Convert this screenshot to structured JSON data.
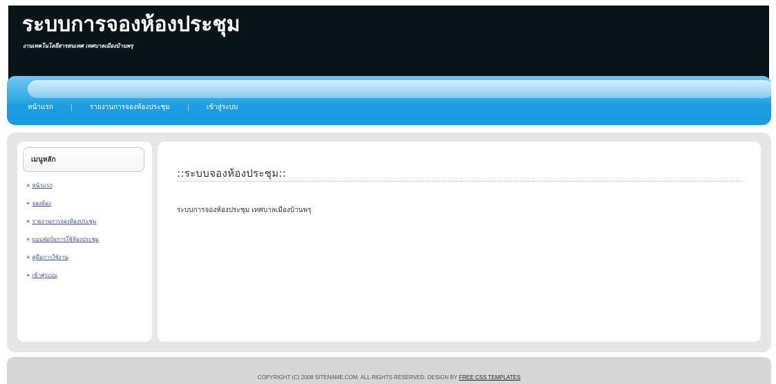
{
  "header": {
    "title": "ระบบการจองห้องประชุม",
    "subtitle": "งานเทคโนโลยีสารสนเทศ เทศบาลเมืองบ้านพรุ"
  },
  "menu": {
    "items": [
      {
        "label": "หน้าแรก"
      },
      {
        "label": "รายงานการจองห้องประชุม"
      },
      {
        "label": "เข้าสู่ระบบ"
      }
    ]
  },
  "sidebar": {
    "heading": "เมนูหลัก",
    "bullet": "»",
    "items": [
      {
        "label": "หน้าแรก"
      },
      {
        "label": "จองห้อง"
      },
      {
        "label": "รายงานการจองห้องประชุม"
      },
      {
        "label": "แบบฟอร์มการใช้ห้องประชุม"
      },
      {
        "label": "คู่มือการใช้งาน"
      },
      {
        "label": "เข้าสู่ระบบ"
      }
    ]
  },
  "content": {
    "title": "::ระบบจองห้องประชุม::",
    "text": "ระบบการจองห้องประชุม เทศบาลเมืองบ้านพรุ"
  },
  "footer": {
    "text": "COPYRIGHT (C) 2008 SITENAME.COM. ALL RIGHTS RESERVED. DESIGN BY ",
    "link_label": "FREE CSS TEMPLATES"
  },
  "colors": {
    "header_bg": "#0b1418",
    "menu_blue": "#1e9ee0",
    "main_bg": "#e6e6e6",
    "footer_bg": "#d6d6d6",
    "sidebar_link": "#3a4a8a"
  }
}
